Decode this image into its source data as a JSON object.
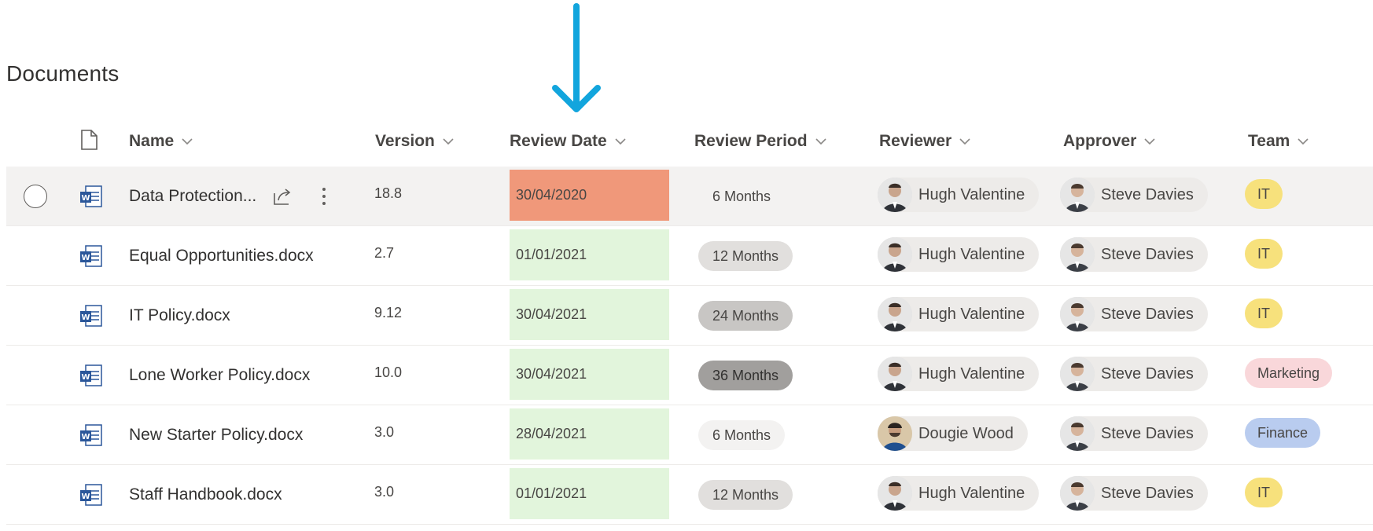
{
  "library_title": "Documents",
  "columns": {
    "name": "Name",
    "version": "Version",
    "review_date": "Review Date",
    "review_period": "Review Period",
    "reviewer": "Reviewer",
    "approver": "Approver",
    "team": "Team"
  },
  "icons": {
    "header_file": "file-icon",
    "doc": "word-doc-icon",
    "share": "share-icon",
    "more": "more-vertical-icon",
    "chevron": "chevron-down-icon",
    "annotation_down": "arrow-down-annotation",
    "annotation_left": "arrow-left-annotation"
  },
  "colors": {
    "overdue": "#f0987a",
    "ok": "#e2f5dc",
    "annotation": "#12a5dd",
    "team_it": "#f7e17c",
    "team_marketing": "#f9d7da",
    "team_finance": "#b9ccef"
  },
  "rows": [
    {
      "name": "Data Protection...",
      "version": "18.8",
      "review_date": "30/04/2020",
      "review_period": "6 Months",
      "reviewer": "Hugh Valentine",
      "approver": "Steve Davies",
      "team": "IT"
    },
    {
      "name": "Equal Opportunities.docx",
      "version": "2.7",
      "review_date": "01/01/2021",
      "review_period": "12 Months",
      "reviewer": "Hugh Valentine",
      "approver": "Steve Davies",
      "team": "IT"
    },
    {
      "name": "IT Policy.docx",
      "version": "9.12",
      "review_date": "30/04/2021",
      "review_period": "24 Months",
      "reviewer": "Hugh Valentine",
      "approver": "Steve Davies",
      "team": "IT"
    },
    {
      "name": "Lone Worker Policy.docx",
      "version": "10.0",
      "review_date": "30/04/2021",
      "review_period": "36 Months",
      "reviewer": "Hugh Valentine",
      "approver": "Steve Davies",
      "team": "Marketing"
    },
    {
      "name": "New Starter Policy.docx",
      "version": "3.0",
      "review_date": "28/04/2021",
      "review_period": "6 Months",
      "reviewer": "Dougie Wood",
      "approver": "Steve Davies",
      "team": "Finance"
    },
    {
      "name": "Staff Handbook.docx",
      "version": "3.0",
      "review_date": "01/01/2021",
      "review_period": "12 Months",
      "reviewer": "Hugh Valentine",
      "approver": "Steve Davies",
      "team": "IT"
    }
  ]
}
